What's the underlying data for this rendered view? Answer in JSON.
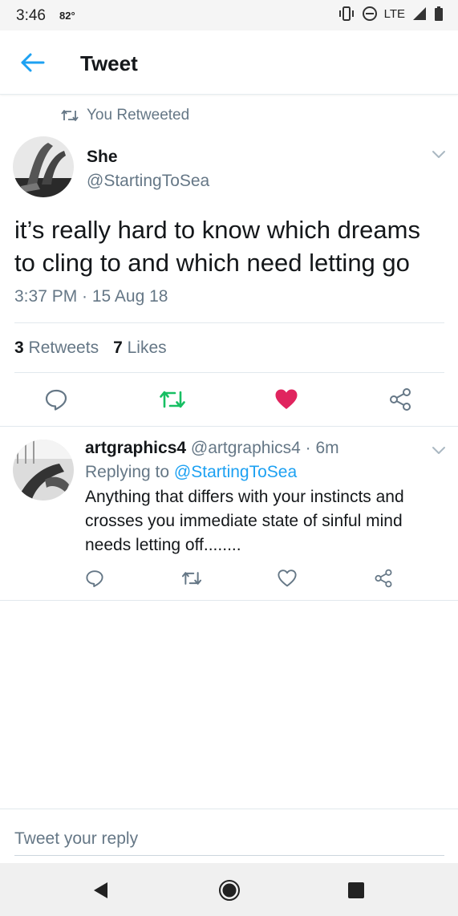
{
  "status_bar": {
    "time": "3:46",
    "temperature": "82°",
    "network": "LTE"
  },
  "header": {
    "title": "Tweet"
  },
  "retweet_context": {
    "label": "You Retweeted"
  },
  "tweet": {
    "author_name": "She",
    "author_handle": "@StartingToSea",
    "text": "it’s really hard to know which dreams to cling to and which need letting go",
    "timestamp": "3:37 PM · 15 Aug 18",
    "retweets_count": "3",
    "retweets_label": "Retweets",
    "likes_count": "7",
    "likes_label": "Likes",
    "liked": true,
    "retweeted": true
  },
  "reply": {
    "author_name": "artgraphics4",
    "author_handle": "@artgraphics4",
    "age": "· 6m",
    "replying_prefix": "Replying to",
    "replying_to": "@StartingToSea",
    "text": "Anything that differs with your instincts and crosses you immediate state of sinful mind needs letting off........"
  },
  "composer": {
    "placeholder": "Tweet your reply"
  },
  "colors": {
    "accent": "#1da1f2",
    "retweet_green": "#17bf63",
    "like_red": "#e0245e",
    "muted": "#657786"
  },
  "icons": [
    "back-arrow-icon",
    "retweet-icon",
    "chevron-down-icon",
    "reply-icon",
    "like-icon",
    "share-icon",
    "nav-back-icon",
    "nav-home-icon",
    "nav-recents-icon"
  ]
}
